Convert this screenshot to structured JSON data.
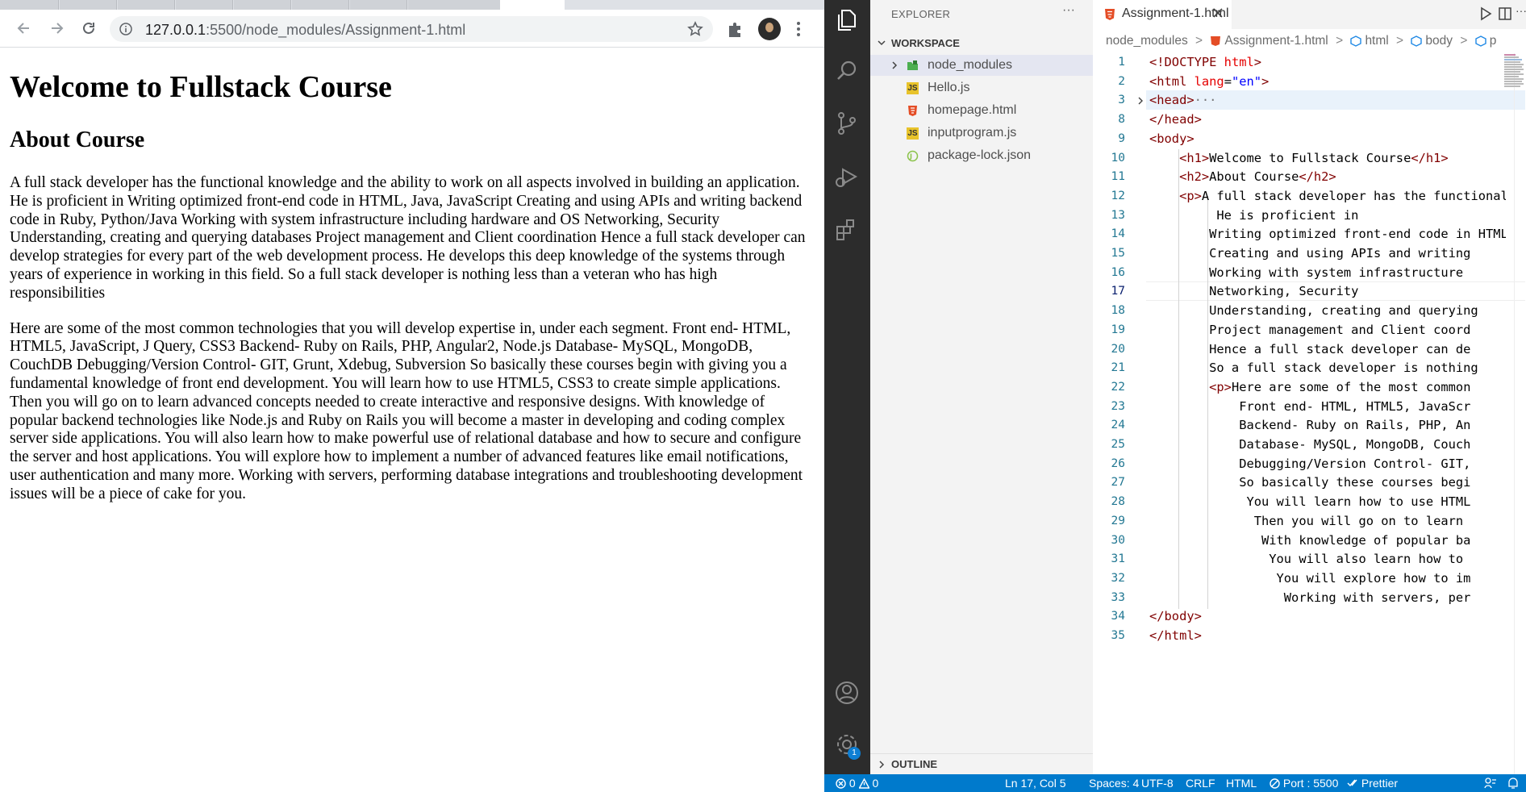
{
  "browser": {
    "url_host": "127.0.0.1",
    "url_path": ":5500/node_modules/Assignment-1.html",
    "page": {
      "h1": "Welcome to Fullstack Course",
      "h2": "About Course",
      "paragraph1": "A full stack developer has the functional knowledge and the ability to work on all aspects involved in building an application. He is proficient in Writing optimized front-end code in HTML, Java, JavaScript Creating and using APIs and writing backend code in Ruby, Python/Java Working with system infrastructure including hardware and OS Networking, Security Understanding, creating and querying databases Project management and Client coordination Hence a full stack developer can develop strategies for every part of the web development process. He develops this deep knowledge of the systems through years of experience in working in this field. So a full stack developer is nothing less than a veteran who has high responsibilities",
      "paragraph2": "Here are some of the most common technologies that you will develop expertise in, under each segment. Front end- HTML, HTML5, JavaScript, J Query, CSS3 Backend- Ruby on Rails, PHP, Angular2, Node.js Database- MySQL, MongoDB, CouchDB Debugging/Version Control- GIT, Grunt, Xdebug, Subversion So basically these courses begin with giving you a fundamental knowledge of front end development. You will learn how to use HTML5, CSS3 to create simple applications. Then you will go on to learn advanced concepts needed to create interactive and responsive designs. With knowledge of popular backend technologies like Node.js and Ruby on Rails you will become a master in developing and coding complex server side applications. You will also learn how to make powerful use of relational database and how to secure and configure the server and host applications. You will explore how to implement a number of advanced features like email notifications, user authentication and many more. Working with servers, performing database integrations and troubleshooting development issues will be a piece of cake for you."
    }
  },
  "vscode": {
    "explorer_title": "EXPLORER",
    "explorer_more": "···",
    "workspace_label": "WORKSPACE",
    "files": [
      {
        "name": "node_modules",
        "icon": "folder-icon",
        "color": "#4caf50"
      },
      {
        "name": "Hello.js",
        "icon": "js-icon",
        "color": "#e8c32b"
      },
      {
        "name": "homepage.html",
        "icon": "html5-icon",
        "color": "#e44d26"
      },
      {
        "name": "inputprogram.js",
        "icon": "js-icon",
        "color": "#e8c32b"
      },
      {
        "name": "package-lock.json",
        "icon": "json-icon",
        "color": "#8bc34a"
      }
    ],
    "outline_label": "OUTLINE",
    "badge": "1",
    "tab_label": "Assignment-1.html",
    "breadcrumb": [
      "node_modules",
      "Assignment-1.html",
      "html",
      "body",
      "p"
    ],
    "status": {
      "problems": "0",
      "warnings": "0",
      "position": "Ln 17, Col 5",
      "spaces": "Spaces: 4",
      "encoding": "UTF-8",
      "eol": "CRLF",
      "language": "HTML",
      "port": "Port : 5500",
      "formatter": "Prettier"
    },
    "accent": "#007acc"
  },
  "code_lines": [
    {
      "n": "1",
      "parts": [
        [
          "tg",
          "<!DOCTYPE "
        ],
        [
          "at",
          "html"
        ],
        [
          "tg",
          ">"
        ]
      ]
    },
    {
      "n": "2",
      "parts": [
        [
          "tg",
          "<html "
        ],
        [
          "at",
          "lang"
        ],
        [
          "",
          "="
        ],
        [
          "st",
          "\"en\""
        ],
        [
          "tg",
          ">"
        ]
      ]
    },
    {
      "n": "3",
      "parts": [
        [
          "tg",
          "<head>"
        ],
        [
          "gy",
          "···"
        ]
      ]
    },
    {
      "n": "8",
      "parts": [
        [
          "tg",
          "</head>"
        ]
      ]
    },
    {
      "n": "9",
      "parts": [
        [
          "tg",
          "<body>"
        ]
      ]
    },
    {
      "n": "10",
      "parts": [
        [
          "",
          "    "
        ],
        [
          "tg",
          "<h1>"
        ],
        [
          "",
          "Welcome to Fullstack Course"
        ],
        [
          "tg",
          "</h1>"
        ]
      ]
    },
    {
      "n": "11",
      "parts": [
        [
          "",
          "    "
        ],
        [
          "tg",
          "<h2>"
        ],
        [
          "",
          "About Course"
        ],
        [
          "tg",
          "</h2>"
        ]
      ]
    },
    {
      "n": "12",
      "parts": [
        [
          "",
          "    "
        ],
        [
          "tg",
          "<p>"
        ],
        [
          "",
          "A full stack developer has the functional"
        ]
      ]
    },
    {
      "n": "13",
      "parts": [
        [
          "",
          "         He is proficient in"
        ]
      ]
    },
    {
      "n": "14",
      "parts": [
        [
          "",
          "        Writing optimized front-end code in HTML"
        ]
      ]
    },
    {
      "n": "15",
      "parts": [
        [
          "",
          "        Creating and using APIs and writing"
        ]
      ]
    },
    {
      "n": "16",
      "parts": [
        [
          "",
          "        Working with system infrastructure"
        ]
      ]
    },
    {
      "n": "17",
      "parts": [
        [
          "",
          "        Networking, Security"
        ]
      ]
    },
    {
      "n": "18",
      "parts": [
        [
          "",
          "        Understanding, creating and querying"
        ]
      ]
    },
    {
      "n": "19",
      "parts": [
        [
          "",
          "        Project management and Client coord"
        ]
      ]
    },
    {
      "n": "20",
      "parts": [
        [
          "",
          "        Hence a full stack developer can de"
        ]
      ]
    },
    {
      "n": "21",
      "parts": [
        [
          "",
          "        So a full stack developer is nothing"
        ]
      ]
    },
    {
      "n": "22",
      "parts": [
        [
          "",
          "        "
        ],
        [
          "tg",
          "<p>"
        ],
        [
          "",
          "Here are some of the most common"
        ]
      ]
    },
    {
      "n": "23",
      "parts": [
        [
          "",
          "            Front end- HTML, HTML5, JavaScr"
        ]
      ]
    },
    {
      "n": "24",
      "parts": [
        [
          "",
          "            Backend- Ruby on Rails, PHP, An"
        ]
      ]
    },
    {
      "n": "25",
      "parts": [
        [
          "",
          "            Database- MySQL, MongoDB, Couch"
        ]
      ]
    },
    {
      "n": "26",
      "parts": [
        [
          "",
          "            Debugging/Version Control- GIT,"
        ]
      ]
    },
    {
      "n": "27",
      "parts": [
        [
          "",
          "            So basically these courses begi"
        ]
      ]
    },
    {
      "n": "28",
      "parts": [
        [
          "",
          "             You will learn how to use HTML"
        ]
      ]
    },
    {
      "n": "29",
      "parts": [
        [
          "",
          "              Then you will go on to learn"
        ]
      ]
    },
    {
      "n": "30",
      "parts": [
        [
          "",
          "               With knowledge of popular ba"
        ]
      ]
    },
    {
      "n": "31",
      "parts": [
        [
          "",
          "                You will also learn how to"
        ]
      ]
    },
    {
      "n": "32",
      "parts": [
        [
          "",
          "                 You will explore how to im"
        ]
      ]
    },
    {
      "n": "33",
      "parts": [
        [
          "",
          "                  Working with servers, per"
        ]
      ]
    },
    {
      "n": "34",
      "parts": [
        [
          "tg",
          "</body>"
        ]
      ]
    },
    {
      "n": "35",
      "parts": [
        [
          "tg",
          "</html>"
        ]
      ]
    }
  ]
}
